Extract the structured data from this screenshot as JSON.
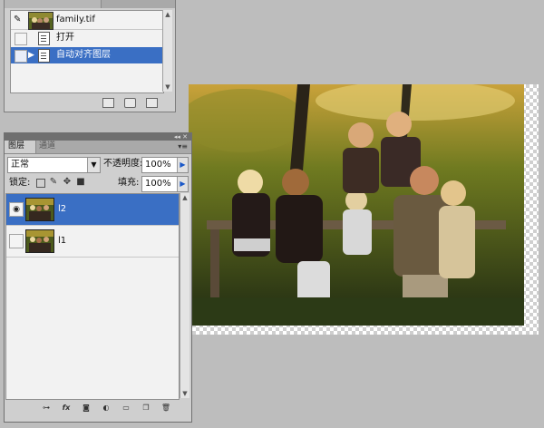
{
  "history_panel": {
    "document_name": "family.tif",
    "items": [
      {
        "label": "打开",
        "state": "normal"
      },
      {
        "label": "自动对齐图层",
        "state": "selected"
      }
    ],
    "footer_icons": [
      "new-document-from-state-icon",
      "camera-snapshot-icon",
      "trash-icon"
    ]
  },
  "layers_panel": {
    "tabs": [
      {
        "label": "图层",
        "active": true
      },
      {
        "label": "通道",
        "active": false
      }
    ],
    "blend_mode": "正常",
    "opacity_label": "不透明度:",
    "opacity_value": "100%",
    "lock_label": "锁定:",
    "fill_label": "填充:",
    "fill_value": "100%",
    "lock_icons": [
      "lock-transparency-icon",
      "lock-paint-icon",
      "lock-move-icon",
      "lock-all-icon"
    ],
    "layers": [
      {
        "name": "l2",
        "visible": true,
        "selected": true
      },
      {
        "name": "l1",
        "visible": false,
        "selected": false
      }
    ],
    "footer_icons": [
      "link-layers-icon",
      "layer-style-icon",
      "layer-mask-icon",
      "adjustment-layer-icon",
      "new-group-icon",
      "new-layer-icon",
      "delete-layer-icon"
    ],
    "footer_glyphs": [
      "⊶",
      "fx",
      "◙",
      "◐",
      "▭",
      "❐",
      "🗑"
    ]
  },
  "canvas": {
    "subject": "family photo",
    "transparent_background": true
  },
  "colors": {
    "selection": "#3a6fc4",
    "panel": "#cfcfcf",
    "workspace": "#bdbdbd"
  }
}
